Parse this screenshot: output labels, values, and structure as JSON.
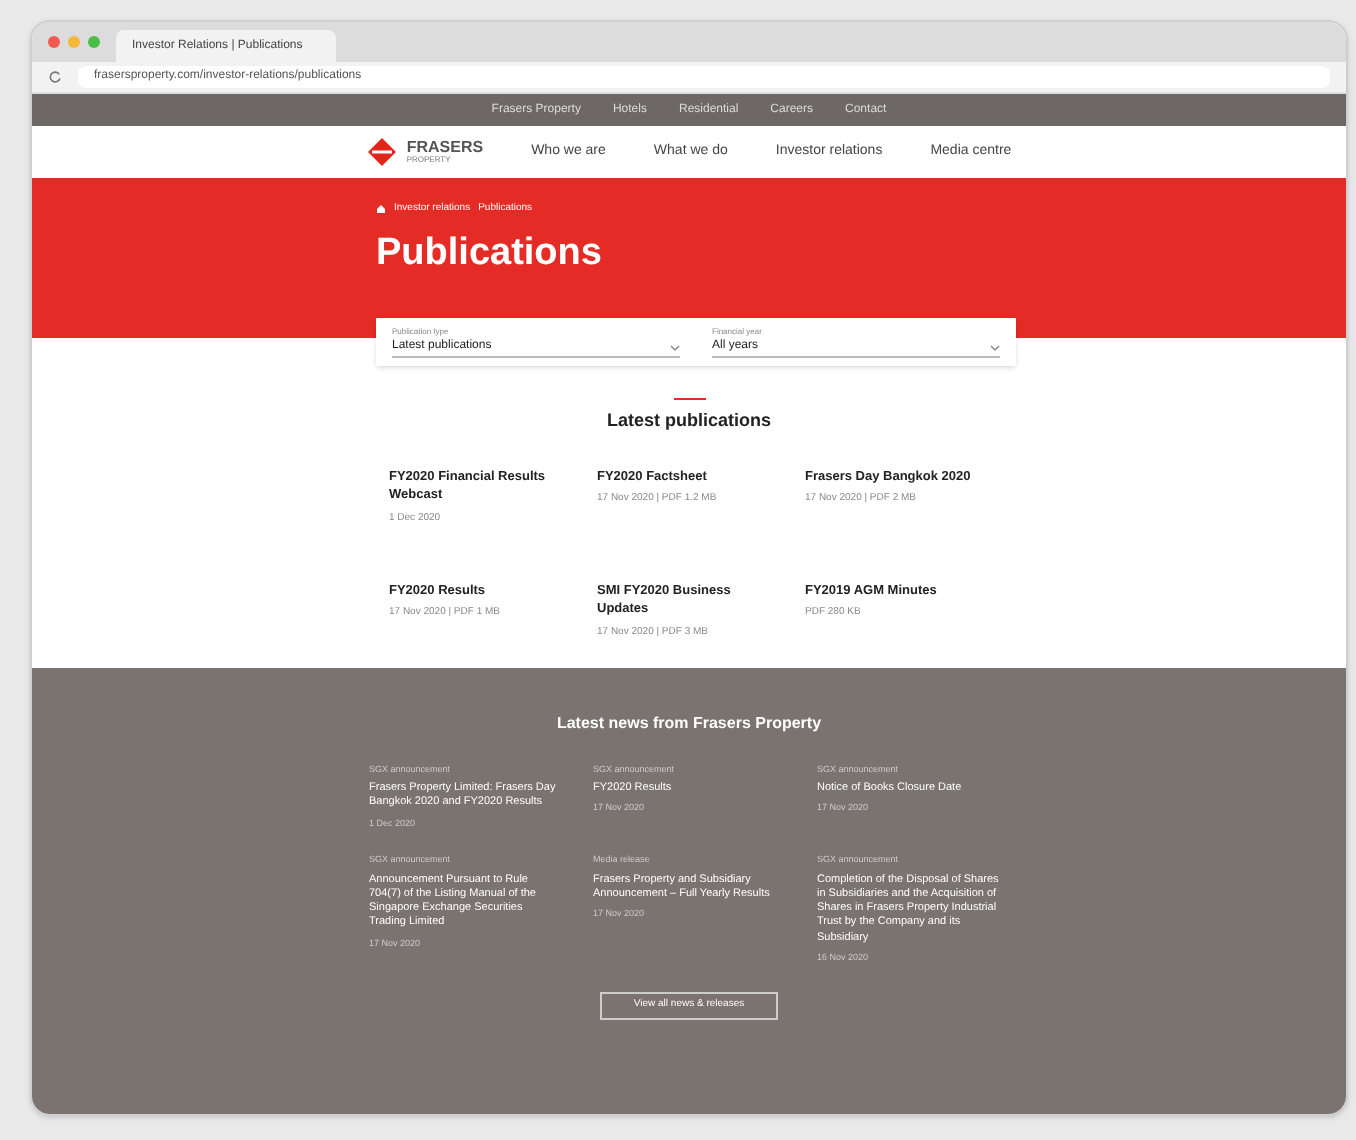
{
  "browser": {
    "tab_title": "Investor Relations | Publications",
    "address": "frasersproperty.com/investor-relations/publications"
  },
  "top_bar": {
    "links": [
      "Frasers Property",
      "Hotels",
      "Residential",
      "Careers",
      "Contact"
    ]
  },
  "nav": {
    "logo": "FRASERS",
    "logo_sub": "PROPERTY",
    "items": [
      "Who we are",
      "What we do",
      "Investor relations",
      "Media centre"
    ]
  },
  "hero": {
    "breadcrumbs": [
      "Investor relations",
      "Publications"
    ],
    "title": "Publications"
  },
  "filters": [
    {
      "label": "Publication type",
      "value": "Latest publications"
    },
    {
      "label": "Financial year",
      "value": "All years"
    }
  ],
  "publications": {
    "title": "Latest publications",
    "items": [
      {
        "title": "FY2020 Financial Results Webcast",
        "meta": "1 Dec 2020"
      },
      {
        "title": "FY2020 Factsheet",
        "meta": "17 Nov 2020 | PDF 1.2 MB"
      },
      {
        "title": "Frasers Day Bangkok 2020",
        "meta": "17 Nov 2020 | PDF 2 MB"
      },
      {
        "title": "FY2020 Results",
        "meta": "17 Nov 2020 | PDF 1 MB"
      },
      {
        "title": "SMI FY2020 Business Updates",
        "meta": "17 Nov 2020 | PDF 3 MB"
      },
      {
        "title": "FY2019 AGM Minutes",
        "meta": "PDF 280 KB"
      }
    ]
  },
  "news": {
    "title": "Latest news from Frasers Property",
    "items": [
      {
        "category": "SGX announcement",
        "title": "Frasers Property Limited: Frasers Day Bangkok 2020 and FY2020 Results",
        "date": "1 Dec 2020"
      },
      {
        "category": "SGX announcement",
        "title": "FY2020 Results",
        "date": "17 Nov 2020"
      },
      {
        "category": "SGX announcement",
        "title": "Notice of Books Closure Date",
        "date": "17 Nov 2020"
      },
      {
        "category": "SGX announcement",
        "title": "Announcement Pursuant to Rule 704(7) of the Listing Manual of the Singapore Exchange Securities Trading Limited",
        "date": "17 Nov 2020"
      },
      {
        "category": "Media release",
        "title": "Frasers Property and Subsidiary Announcement – Full Yearly Results",
        "date": "17 Nov 2020"
      },
      {
        "category": "SGX announcement",
        "title": "Completion of the Disposal of Shares in Subsidiaries and the Acquisition of Shares in Frasers Property Industrial Trust by the Company and its Subsidiary",
        "date": "16 Nov 2020"
      }
    ],
    "button": "View all news & releases"
  }
}
